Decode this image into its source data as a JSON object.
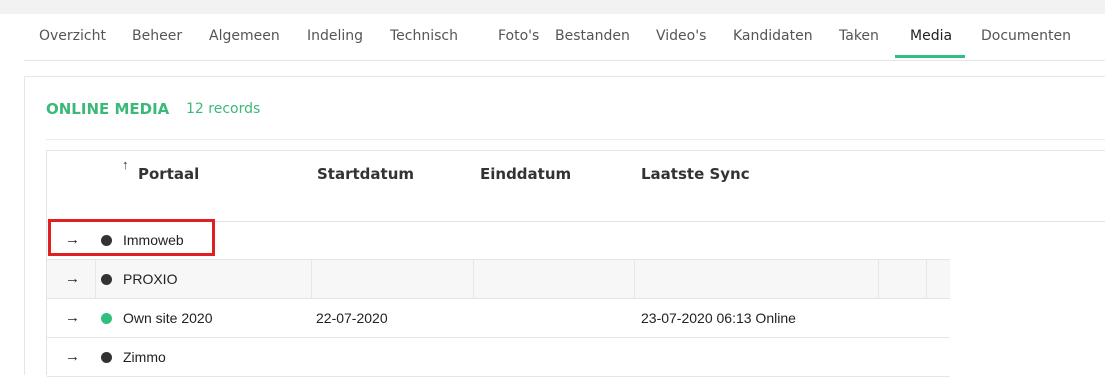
{
  "tabs": [
    {
      "label": "Overzicht",
      "active": false
    },
    {
      "label": "Beheer",
      "active": false
    },
    {
      "label": "Algemeen",
      "active": false
    },
    {
      "label": "Indeling",
      "active": false
    },
    {
      "label": "Technisch",
      "active": false
    },
    {
      "label": "Foto's",
      "active": false
    },
    {
      "label": "Bestanden",
      "active": false
    },
    {
      "label": "Video's",
      "active": false
    },
    {
      "label": "Kandidaten",
      "active": false
    },
    {
      "label": "Taken",
      "active": false
    },
    {
      "label": "Media",
      "active": true
    },
    {
      "label": "Documenten",
      "active": false
    }
  ],
  "section": {
    "title": "ONLINE MEDIA",
    "count": "12 records"
  },
  "table": {
    "sort_icon": "↑",
    "columns": [
      "Portaal",
      "Startdatum",
      "Einddatum",
      "Laatste Sync"
    ],
    "rows": [
      {
        "arrow": "→",
        "status_color": "#333333",
        "portaal": "Immoweb",
        "startdatum": "",
        "einddatum": "",
        "laatste_sync": "",
        "highlighted": true
      },
      {
        "arrow": "→",
        "status_color": "#333333",
        "portaal": "PROXIO",
        "startdatum": "",
        "einddatum": "",
        "laatste_sync": "",
        "highlighted": false
      },
      {
        "arrow": "→",
        "status_color": "#2fbf7f",
        "portaal": "Own site 2020",
        "startdatum": "22-07-2020",
        "einddatum": "",
        "laatste_sync": "23-07-2020 06:13 Online",
        "highlighted": false
      },
      {
        "arrow": "→",
        "status_color": "#333333",
        "portaal": "Zimmo",
        "startdatum": "",
        "einddatum": "",
        "laatste_sync": "",
        "highlighted": false
      }
    ]
  },
  "colors": {
    "accent_green": "#3cb878",
    "tab_underline": "#2fbf7f",
    "highlight_red": "#e02020"
  }
}
